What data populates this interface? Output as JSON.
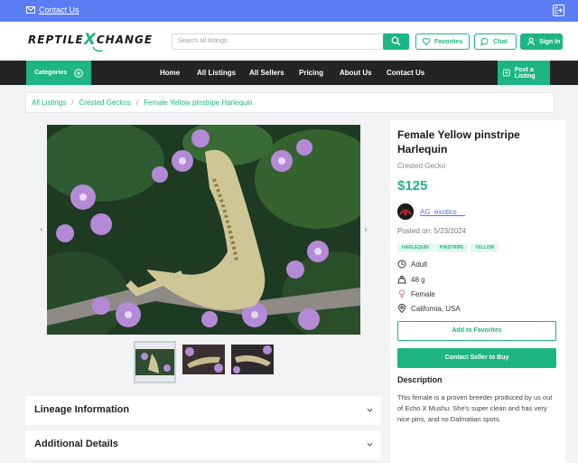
{
  "topbar": {
    "contact_label": "Contact Us"
  },
  "header": {
    "logo_left": "REPTILE",
    "logo_x": "X",
    "logo_right": "CHANGE",
    "search_placeholder": "Search all listings",
    "favorites_label": "Favorites",
    "chat_label": "Chat",
    "signin_label": "Sign In"
  },
  "nav": {
    "categories_label": "Categories",
    "links": [
      "Home",
      "All Listings",
      "All Sellers",
      "Pricing",
      "About Us",
      "Contact Us"
    ],
    "post_label": "Post a Listing"
  },
  "breadcrumb": [
    "All Listings",
    "Crested Geckos",
    "Female Yellow pinstripe Harlequin"
  ],
  "listing": {
    "title": "Female Yellow pinstripe Harlequin",
    "species": "Crested Gecko",
    "price": "$125",
    "seller": "AG_exotics__",
    "posted": "Posted on: 5/23/2024",
    "tags": [
      "HARLEQUIN",
      "PINSTRIPE",
      "YELLOW"
    ],
    "attributes": {
      "age": "Adult",
      "weight": "48 g",
      "sex": "Female",
      "location": "California, USA"
    },
    "add_favorites_label": "Add to Favorites",
    "contact_label": "Contact Seller to Buy",
    "description_heading": "Description",
    "description": "This female is a proven breeder produced by us out of Echo X Mushu. She's super clean and has very nice pins, and no Dalmatian spots."
  },
  "sections": {
    "lineage": "Lineage Information",
    "additional": "Additional Details"
  },
  "colors": {
    "accent": "#1db584",
    "topbar": "#5b7df4",
    "nav": "#242424",
    "link": "#5b6ef0"
  },
  "icons": [
    "envelope-icon",
    "logout-icon",
    "search-icon",
    "heart-icon",
    "chat-icon",
    "user-icon",
    "plus-circle-icon",
    "plus-square-icon",
    "clock-icon",
    "weight-icon",
    "female-icon",
    "location-pin-icon",
    "chevron-down-icon",
    "chevron-left-icon",
    "chevron-right-icon"
  ]
}
